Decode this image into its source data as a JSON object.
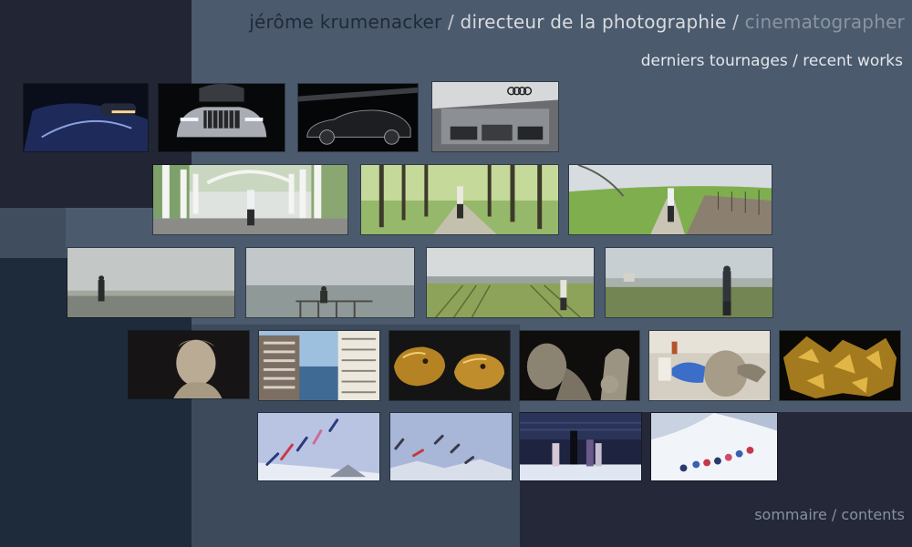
{
  "header": {
    "name": "jérôme krumenacker",
    "sep1": " / ",
    "role_fr": "directeur de la photographie",
    "sep2": " / ",
    "role_en": "cinematographer"
  },
  "section": {
    "label_fr": "derniers tournages",
    "sep": " / ",
    "label_en": "recent works"
  },
  "footer": {
    "sommaire": "sommaire",
    "sep": " / ",
    "contents": "contents"
  },
  "gallery": {
    "rows": [
      [
        "car-door-night",
        "audi-front-grille",
        "car-side-silhouette",
        "audi-showroom"
      ],
      [
        "woman-walking-bridge",
        "woman-walking-forest",
        "woman-walking-vineyard"
      ],
      [
        "man-city-overlook",
        "man-lake-railing",
        "woman-vineyard-hill",
        "man-valley-view"
      ],
      [
        "roman-bust",
        "city-buildings-sea",
        "golden-animal-heads",
        "marble-statue-dark",
        "blue-gloved-hands-lab",
        "golden-fragments"
      ],
      [
        "ski-jumpers-sky",
        "skiers-airborne",
        "ice-skaters-stadium",
        "skiers-snow-slope"
      ]
    ]
  },
  "colors": {
    "background": "#4b5a6d",
    "name_text": "#1f2a38",
    "role_text": "#d8dbe0",
    "muted_text": "#8a95a3"
  }
}
